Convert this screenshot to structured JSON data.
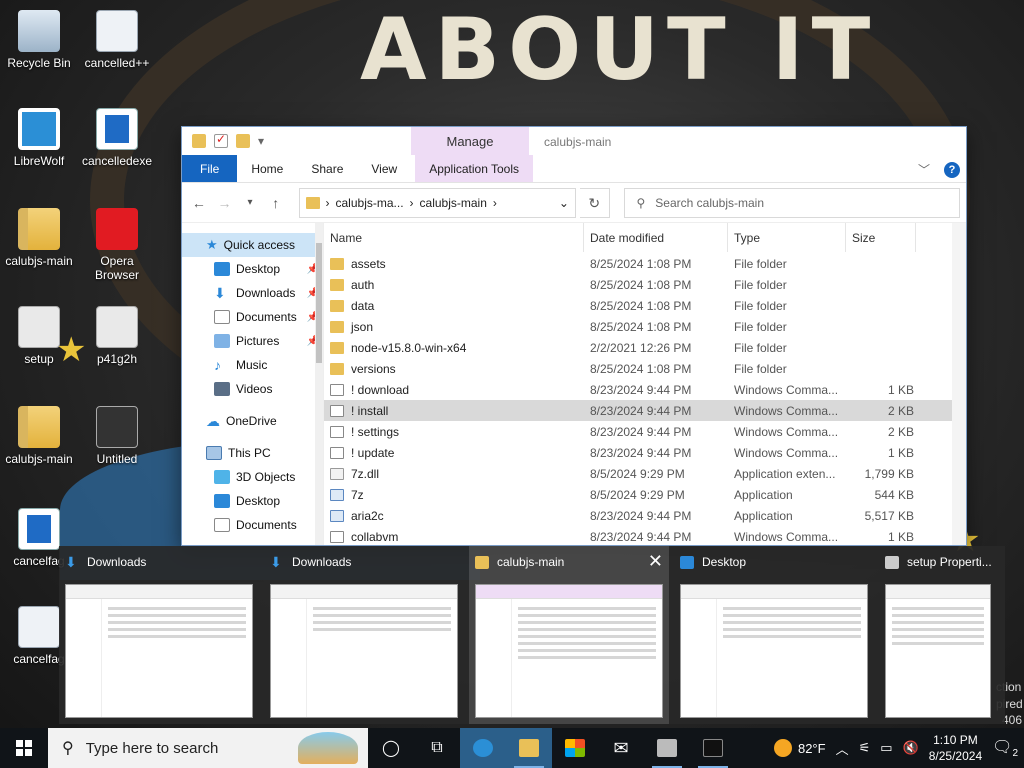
{
  "desktop": {
    "icons": [
      {
        "label": "Recycle Bin"
      },
      {
        "label": "cancelled++"
      },
      {
        "label": "LibreWolf"
      },
      {
        "label": "cancelledexe"
      },
      {
        "label": "calubjs-main"
      },
      {
        "label": "Opera Browser"
      },
      {
        "label": "setup"
      },
      {
        "label": "p41g2h"
      },
      {
        "label": "calubjs-main"
      },
      {
        "label": "Untitled"
      },
      {
        "label": "cancelfag"
      },
      {
        "label": "cancelfag"
      }
    ],
    "edge_text": [
      "ction",
      "pired",
      "406"
    ]
  },
  "explorer": {
    "title": "calubjs-main",
    "ribbon_manage": "Manage",
    "ribbon_tabs": [
      "File",
      "Home",
      "Share",
      "View"
    ],
    "ribbon_app_tools": "Application Tools",
    "address": {
      "crumb1": "calubjs-ma...",
      "crumb2": "calubjs-main"
    },
    "search_placeholder": "Search calubjs-main",
    "nav": [
      {
        "label": "Quick access"
      },
      {
        "label": "Desktop"
      },
      {
        "label": "Downloads"
      },
      {
        "label": "Documents"
      },
      {
        "label": "Pictures"
      },
      {
        "label": "Music"
      },
      {
        "label": "Videos"
      },
      {
        "label": "OneDrive"
      },
      {
        "label": "This PC"
      },
      {
        "label": "3D Objects"
      },
      {
        "label": "Desktop"
      },
      {
        "label": "Documents"
      }
    ],
    "columns": {
      "name": "Name",
      "date": "Date modified",
      "type": "Type",
      "size": "Size"
    },
    "files": [
      {
        "name": "assets",
        "date": "8/25/2024 1:08 PM",
        "type": "File folder",
        "size": "",
        "kind": "folder"
      },
      {
        "name": "auth",
        "date": "8/25/2024 1:08 PM",
        "type": "File folder",
        "size": "",
        "kind": "folder"
      },
      {
        "name": "data",
        "date": "8/25/2024 1:08 PM",
        "type": "File folder",
        "size": "",
        "kind": "folder"
      },
      {
        "name": "json",
        "date": "8/25/2024 1:08 PM",
        "type": "File folder",
        "size": "",
        "kind": "folder"
      },
      {
        "name": "node-v15.8.0-win-x64",
        "date": "2/2/2021 12:26 PM",
        "type": "File folder",
        "size": "",
        "kind": "folder"
      },
      {
        "name": "versions",
        "date": "8/25/2024 1:08 PM",
        "type": "File folder",
        "size": "",
        "kind": "folder"
      },
      {
        "name": "! download",
        "date": "8/23/2024 9:44 PM",
        "type": "Windows Comma...",
        "size": "1 KB",
        "kind": "cmd"
      },
      {
        "name": "! install",
        "date": "8/23/2024 9:44 PM",
        "type": "Windows Comma...",
        "size": "2 KB",
        "kind": "cmd"
      },
      {
        "name": "! settings",
        "date": "8/23/2024 9:44 PM",
        "type": "Windows Comma...",
        "size": "2 KB",
        "kind": "cmd"
      },
      {
        "name": "! update",
        "date": "8/23/2024 9:44 PM",
        "type": "Windows Comma...",
        "size": "1 KB",
        "kind": "cmd"
      },
      {
        "name": "7z.dll",
        "date": "8/5/2024 9:29 PM",
        "type": "Application exten...",
        "size": "1,799 KB",
        "kind": "dll"
      },
      {
        "name": "7z",
        "date": "8/5/2024 9:29 PM",
        "type": "Application",
        "size": "544 KB",
        "kind": "app"
      },
      {
        "name": "aria2c",
        "date": "8/23/2024 9:44 PM",
        "type": "Application",
        "size": "5,517 KB",
        "kind": "app"
      },
      {
        "name": "collabvm",
        "date": "8/23/2024 9:44 PM",
        "type": "Windows Comma...",
        "size": "1 KB",
        "kind": "cmd"
      }
    ],
    "selected_row": "! install"
  },
  "thumbnails": [
    {
      "title": "Downloads",
      "icon": "download-icon"
    },
    {
      "title": "Downloads",
      "icon": "download-icon"
    },
    {
      "title": "calubjs-main",
      "icon": "folder-icon"
    },
    {
      "title": "Desktop",
      "icon": "desktop-icon"
    },
    {
      "title": "setup Properti...",
      "icon": "properties-icon"
    }
  ],
  "taskbar": {
    "search_placeholder": "Type here to search",
    "weather": "82°F",
    "time": "1:10 PM",
    "date": "8/25/2024",
    "notifications": "2"
  }
}
